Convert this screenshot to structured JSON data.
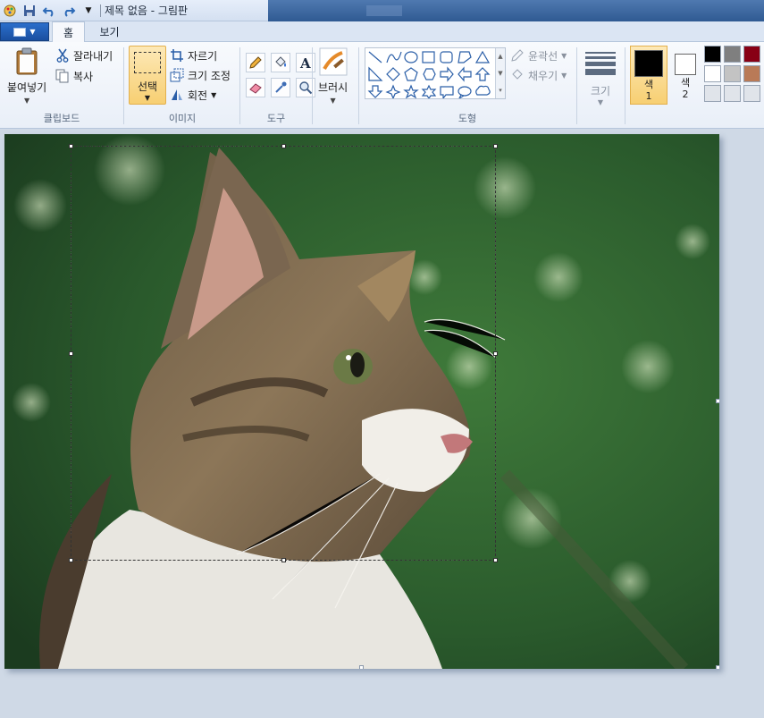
{
  "window": {
    "title": "제목 없음 - 그림판"
  },
  "tabs": {
    "home": "홈",
    "view": "보기"
  },
  "ribbon": {
    "clipboard": {
      "label": "클립보드",
      "paste": "붙여넣기",
      "cut": "잘라내기",
      "copy": "복사"
    },
    "image": {
      "label": "이미지",
      "select": "선택",
      "crop": "자르기",
      "resize": "크기 조정",
      "rotate": "회전"
    },
    "tools": {
      "label": "도구"
    },
    "brushes": {
      "label": "브러시"
    },
    "shapes": {
      "label": "도형",
      "outline": "윤곽선",
      "fill": "채우기"
    },
    "size": {
      "label": "크기"
    },
    "colors": {
      "color1_label": "색\n1",
      "color2_label": "색\n2",
      "color1": "#000000",
      "color2": "#ffffff",
      "palette": [
        "#000000",
        "#7f7f7f",
        "#880015",
        "#ffffff",
        "#c3c3c3",
        "#b97a57",
        "#e0e4ea",
        "#e0e4ea",
        "#e0e4ea"
      ]
    }
  },
  "canvas": {
    "image_description": "tabby cat"
  }
}
